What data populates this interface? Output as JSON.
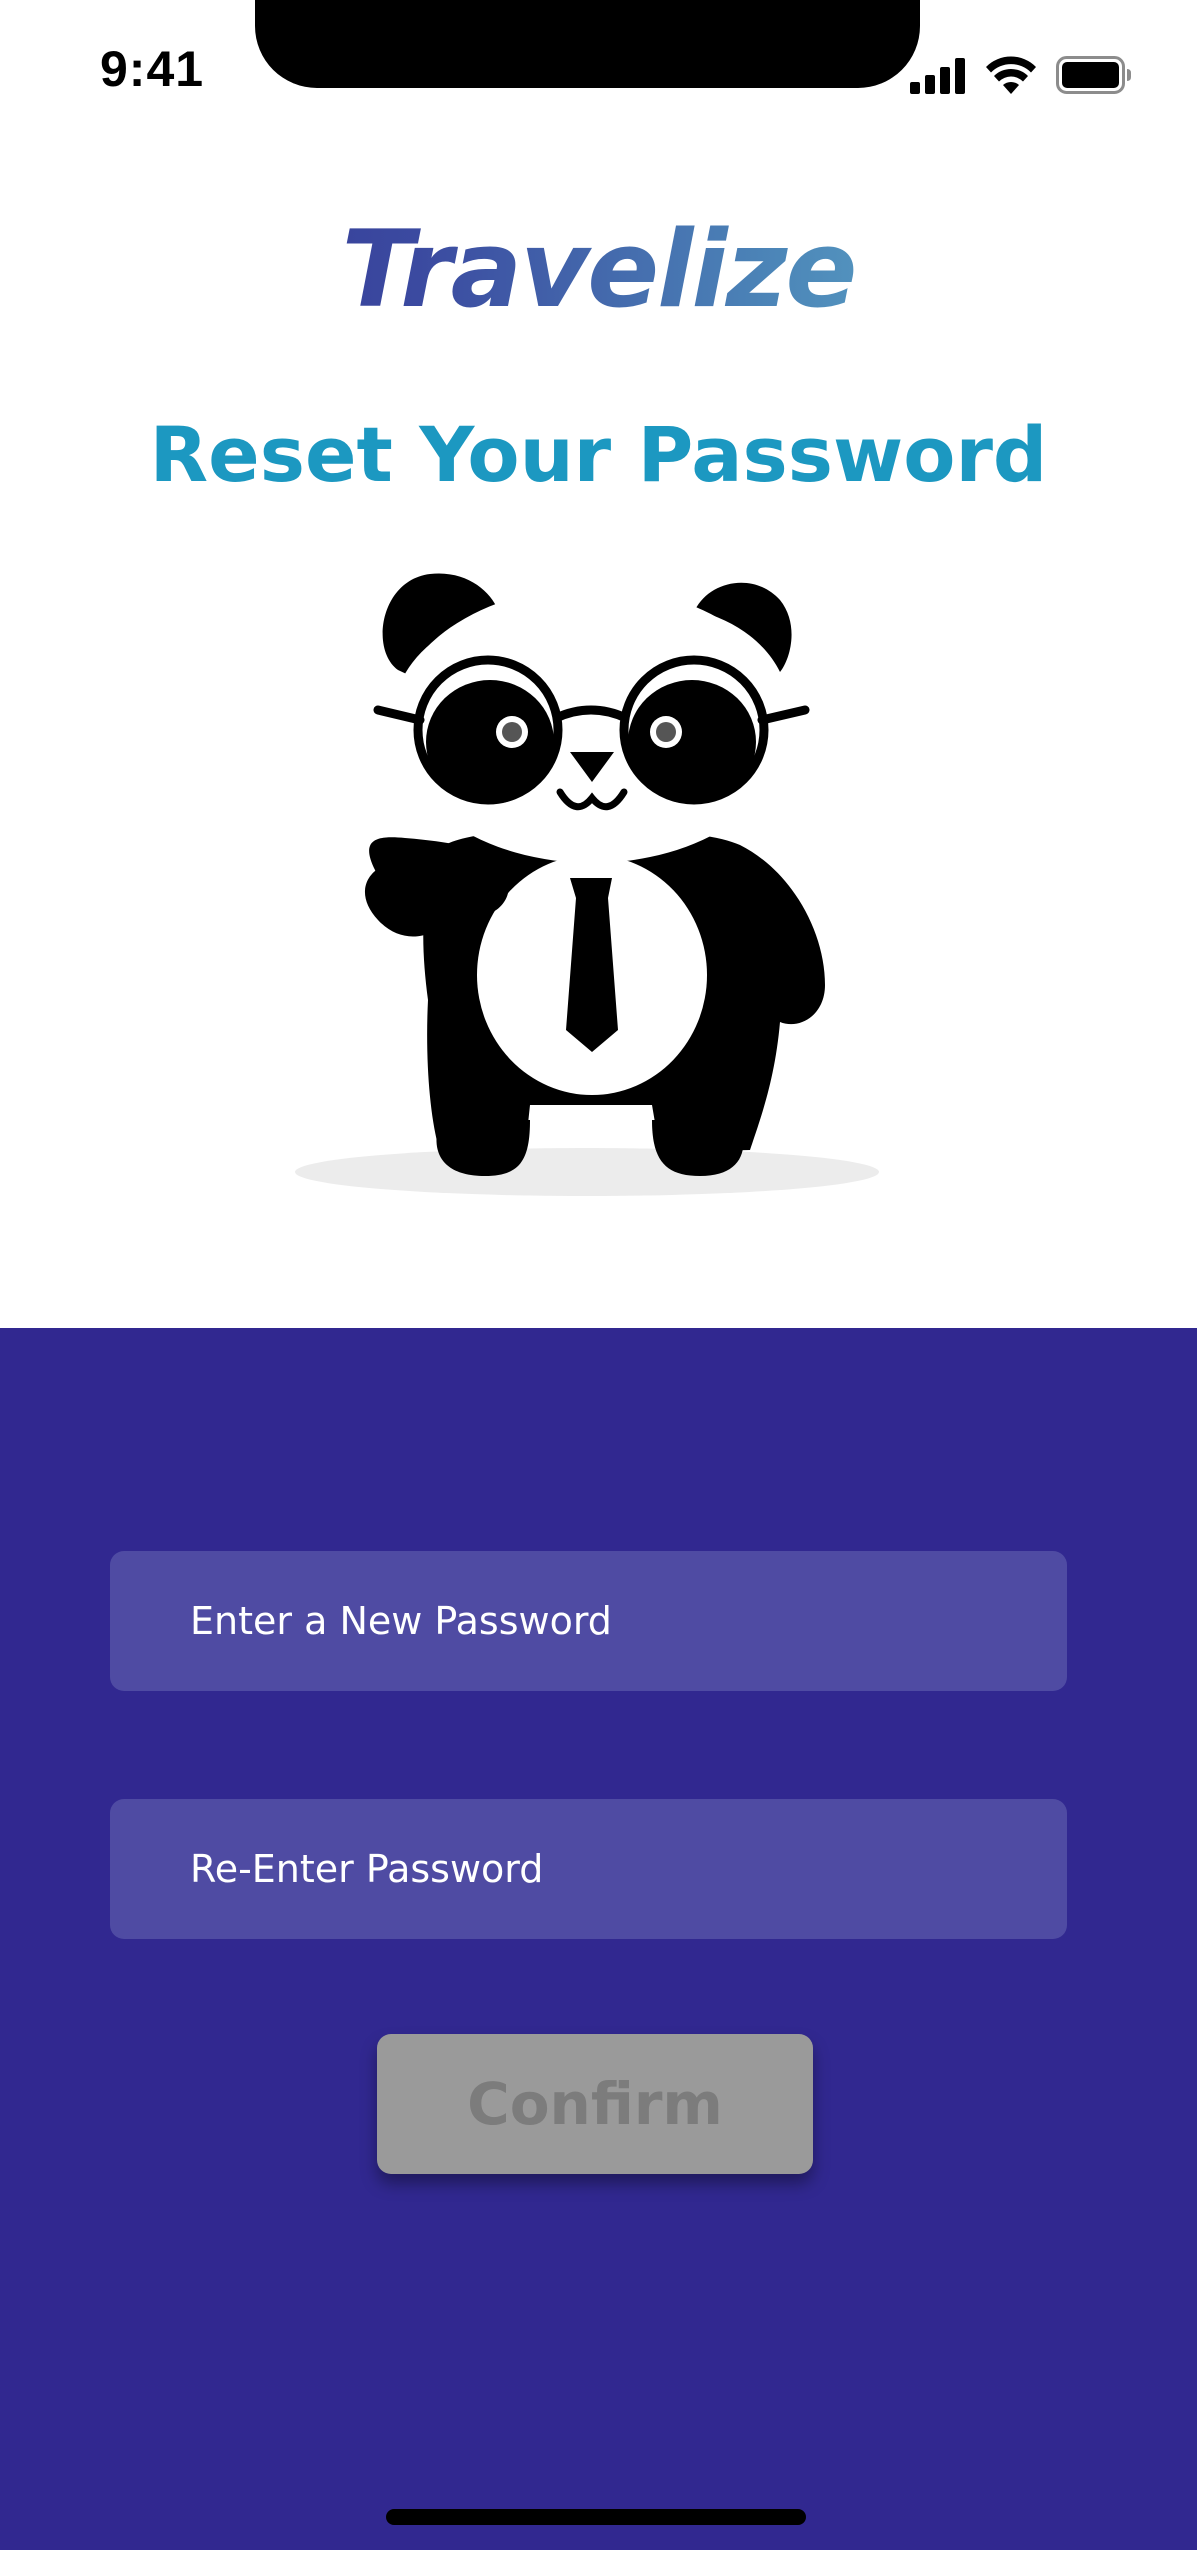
{
  "status_bar": {
    "time": "9:41",
    "icons": [
      "signal-icon",
      "wifi-icon",
      "battery-icon"
    ]
  },
  "app": {
    "logo_text": "Travelize",
    "logo_colors": [
      "#2e2c8f",
      "#4c86b8",
      "#6cc4d6"
    ]
  },
  "header": {
    "title": "Reset Your Password",
    "title_color": "#1c98c1"
  },
  "illustration": {
    "name": "panda-illustration"
  },
  "form": {
    "background_color": "#312890",
    "new_password": {
      "placeholder": "Enter a New Password",
      "value": ""
    },
    "reenter_password": {
      "placeholder": "Re-Enter Password",
      "value": ""
    },
    "confirm_label": "Confirm",
    "confirm_state": "disabled"
  }
}
